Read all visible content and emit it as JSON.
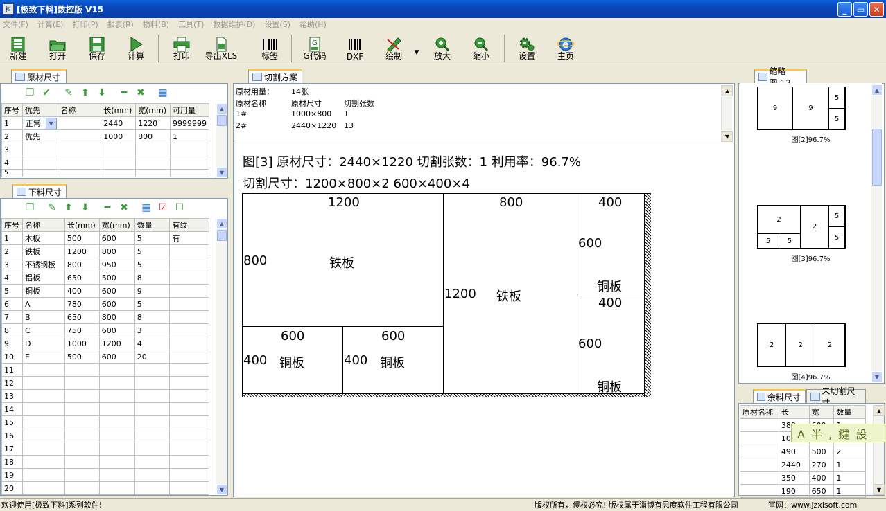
{
  "window": {
    "title": "[极致下料]数控版 V15",
    "app_icon": "app-icon"
  },
  "menu": [
    "文件(F)",
    "计算(E)",
    "打印(P)",
    "报表(R)",
    "物料(B)",
    "工具(T)",
    "数据维护(D)",
    "设置(S)",
    "帮助(H)"
  ],
  "toolbar": {
    "new": "新建",
    "open": "打开",
    "save": "保存",
    "calc": "计算",
    "print": "打印",
    "export": "导出XLS",
    "label": "标签",
    "gcode": "G代码",
    "dxf": "DXF",
    "draw": "绘制",
    "zoom_in": "放大",
    "zoom_out": "缩小",
    "settings": "设置",
    "home": "主页"
  },
  "raw_panel": {
    "tab": "原材尺寸",
    "columns": [
      "序号",
      "优先",
      "名称",
      "长(mm)",
      "宽(mm)",
      "可用量"
    ],
    "rows": [
      [
        "1",
        "正常",
        "",
        "2440",
        "1220",
        "9999999"
      ],
      [
        "2",
        "优先",
        "",
        "1000",
        "800",
        "1"
      ],
      [
        "3",
        "",
        "",
        "",
        "",
        ""
      ],
      [
        "4",
        "",
        "",
        "",
        "",
        ""
      ],
      [
        "5",
        "",
        "",
        "",
        "",
        ""
      ]
    ]
  },
  "cut_panel": {
    "tab": "下料尺寸",
    "columns": [
      "序号",
      "名称",
      "长(mm)",
      "宽(mm)",
      "数量",
      "有纹"
    ],
    "rows": [
      [
        "1",
        "木板",
        "500",
        "600",
        "5",
        "有"
      ],
      [
        "2",
        "铁板",
        "1200",
        "800",
        "5",
        ""
      ],
      [
        "3",
        "不锈钢板",
        "800",
        "950",
        "5",
        ""
      ],
      [
        "4",
        "铝板",
        "650",
        "500",
        "8",
        ""
      ],
      [
        "5",
        "铜板",
        "400",
        "600",
        "9",
        ""
      ],
      [
        "6",
        "A",
        "780",
        "600",
        "5",
        ""
      ],
      [
        "7",
        "B",
        "650",
        "800",
        "8",
        ""
      ],
      [
        "8",
        "C",
        "750",
        "600",
        "3",
        ""
      ],
      [
        "9",
        "D",
        "1000",
        "1200",
        "4",
        ""
      ],
      [
        "10",
        "E",
        "500",
        "600",
        "20",
        ""
      ],
      [
        "11",
        "",
        "",
        "",
        "",
        ""
      ],
      [
        "12",
        "",
        "",
        "",
        "",
        ""
      ],
      [
        "13",
        "",
        "",
        "",
        "",
        ""
      ],
      [
        "14",
        "",
        "",
        "",
        "",
        ""
      ],
      [
        "15",
        "",
        "",
        "",
        "",
        ""
      ],
      [
        "16",
        "",
        "",
        "",
        "",
        ""
      ],
      [
        "17",
        "",
        "",
        "",
        "",
        ""
      ],
      [
        "18",
        "",
        "",
        "",
        "",
        ""
      ],
      [
        "19",
        "",
        "",
        "",
        "",
        ""
      ],
      [
        "20",
        "",
        "",
        "",
        "",
        ""
      ]
    ]
  },
  "plan": {
    "tab": "切割方案",
    "usage_label": "原材用量：",
    "usage_value": "14张",
    "head": [
      "原材名称",
      "原材尺寸",
      "切割张数"
    ],
    "rows": [
      [
        "1#",
        "1000×800",
        "1"
      ],
      [
        "2#",
        "2440×1220",
        "13"
      ]
    ]
  },
  "diagram": {
    "line1": "图[3] 原材尺寸：2440×1220   切割张数：1   利用率：96.7%",
    "line2": "切割尺寸：1200×800×2  600×400×4",
    "pieces": [
      {
        "top": "1200",
        "left": "800",
        "center": "铁板"
      },
      {
        "top": "800",
        "left": "1200",
        "center": "铁板"
      },
      {
        "top": "600",
        "left": "400",
        "center": "铜板"
      },
      {
        "top": "600",
        "left": "400",
        "center": "铜板"
      },
      {
        "top": "400",
        "left": "600",
        "center": "铜板"
      },
      {
        "top": "400",
        "left": "600",
        "center": "铜板"
      }
    ]
  },
  "thumbnails": {
    "tab": "缩略图:12",
    "items": [
      {
        "caption": "图[2]96.7%",
        "labels": [
          "9",
          "9",
          "5",
          "5"
        ]
      },
      {
        "caption": "图[3]96.7%",
        "labels": [
          "2",
          "2",
          "5",
          "5",
          "5",
          "5"
        ]
      },
      {
        "caption": "图[4]96.7%",
        "labels": [
          "2",
          "2",
          "2"
        ]
      }
    ]
  },
  "remnant": {
    "tab1": "余料尺寸",
    "tab2": "未切割尺寸",
    "columns": [
      "原材名称",
      "长",
      "宽",
      "数量"
    ],
    "rows": [
      [
        "",
        "380",
        "600",
        "1"
      ],
      [
        "",
        "100",
        "",
        ""
      ],
      [
        "",
        "490",
        "500",
        "2"
      ],
      [
        "",
        "2440",
        "270",
        "1"
      ],
      [
        "",
        "350",
        "400",
        "1"
      ],
      [
        "",
        "190",
        "650",
        "1"
      ]
    ],
    "watermark": "A 半 , 鍵 設"
  },
  "status": {
    "left": "欢迎使用[极致下料]系列软件!",
    "copyright": "版权所有，侵权必究! 版权属于淄博有思度软件工程有限公司",
    "site": "官网：www.jzxlsoft.com"
  },
  "colors": {
    "title_bar": "#0846b8",
    "tab_accent": "#ffc83c",
    "grid_border": "#c0c0c0"
  }
}
